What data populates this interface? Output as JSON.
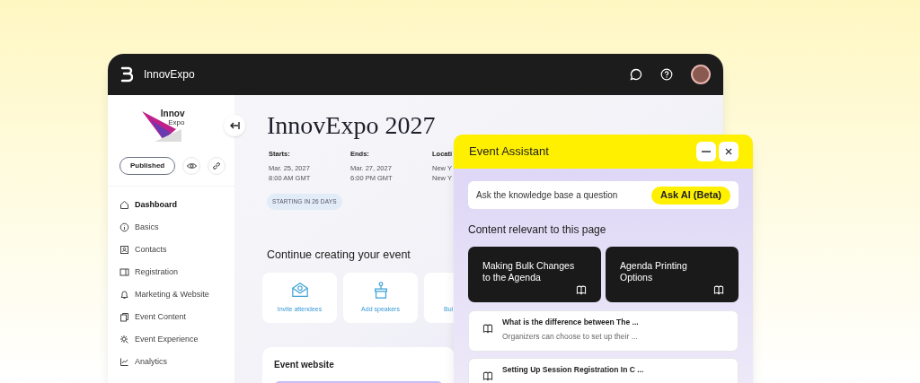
{
  "app": {
    "brand": "InnovExpo"
  },
  "sidebar": {
    "logo": {
      "line_1": "Innov",
      "line_2": "Expo"
    },
    "status_button": "Published",
    "nav": [
      {
        "label": "Dashboard",
        "selected": true
      },
      {
        "label": "Basics",
        "selected": false
      },
      {
        "label": "Contacts",
        "selected": false
      },
      {
        "label": "Registration",
        "selected": false
      },
      {
        "label": "Marketing & Website",
        "selected": false
      },
      {
        "label": "Event Content",
        "selected": false
      },
      {
        "label": "Event Experience",
        "selected": false
      },
      {
        "label": "Analytics",
        "selected": false
      }
    ]
  },
  "event": {
    "title": "InnovExpo 2027",
    "dates": [
      {
        "label": "Starts:",
        "line_1": "Mar. 25, 2027",
        "line_2": "8:00 AM GMT"
      },
      {
        "label": "Ends:",
        "line_1": "Mar. 27, 2027",
        "line_2": "6:00 PM GMT"
      },
      {
        "label": "Locati",
        "line_1": "New Y",
        "line_2": "New Y"
      }
    ],
    "countdown": "STARTING IN 26 DAYS"
  },
  "continue": {
    "heading": "Continue creating your event",
    "actions": [
      {
        "label": "Invite attendees"
      },
      {
        "label": "Add speakers"
      },
      {
        "label": "Bui"
      }
    ]
  },
  "website_card": {
    "heading": "Event website"
  },
  "assistant": {
    "title": "Event Assistant",
    "ask_placeholder": "Ask the knowledge base a question",
    "ask_button": "Ask AI (Beta)",
    "section": "Content relevant to this page",
    "featured": [
      {
        "title": "Making Bulk Changes to the Agenda"
      },
      {
        "title": "Agenda Printing Options"
      }
    ],
    "articles": [
      {
        "title": "What is the difference between The ...",
        "snippet": "Organizers can choose to set up their ..."
      },
      {
        "title": "Setting Up Session Registration In C ..."
      }
    ]
  }
}
